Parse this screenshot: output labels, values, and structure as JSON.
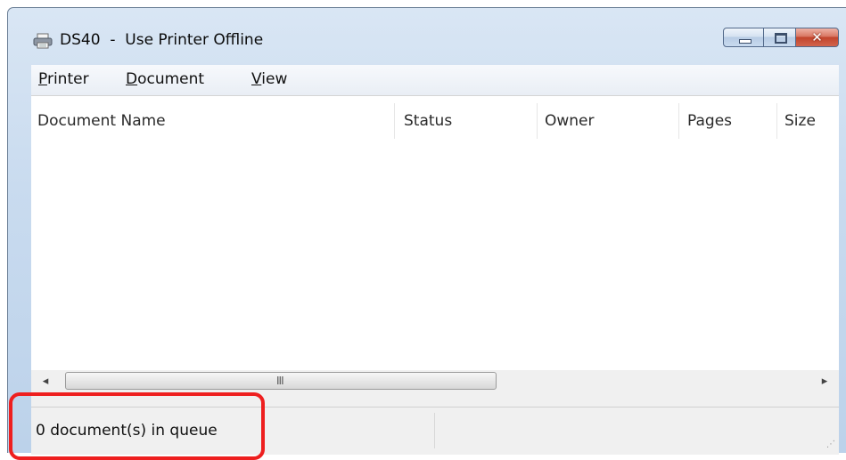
{
  "window": {
    "title": "DS40  -  Use Printer Offline",
    "icon": "printer-icon",
    "buttons": {
      "minimize": "minimize-icon",
      "maximize": "maximize-icon",
      "close": "close-icon"
    }
  },
  "menu": {
    "items": [
      {
        "label": "Printer",
        "accel": "P",
        "rest": "rinter"
      },
      {
        "label": "Document",
        "accel": "D",
        "rest": "ocument"
      },
      {
        "label": "View",
        "accel": "V",
        "rest": "iew"
      }
    ]
  },
  "list": {
    "columns": [
      "Document Name",
      "Status",
      "Owner",
      "Pages",
      "Size"
    ],
    "rows": []
  },
  "scrollbar": {
    "left_arrow": "◂",
    "right_arrow": "▸",
    "grip": "III"
  },
  "status": {
    "queue_text": "0 document(s) in queue"
  },
  "colors": {
    "highlight": "#ee1f1f",
    "window_frame": "#c9dbef",
    "close_button": "#c1442c"
  }
}
